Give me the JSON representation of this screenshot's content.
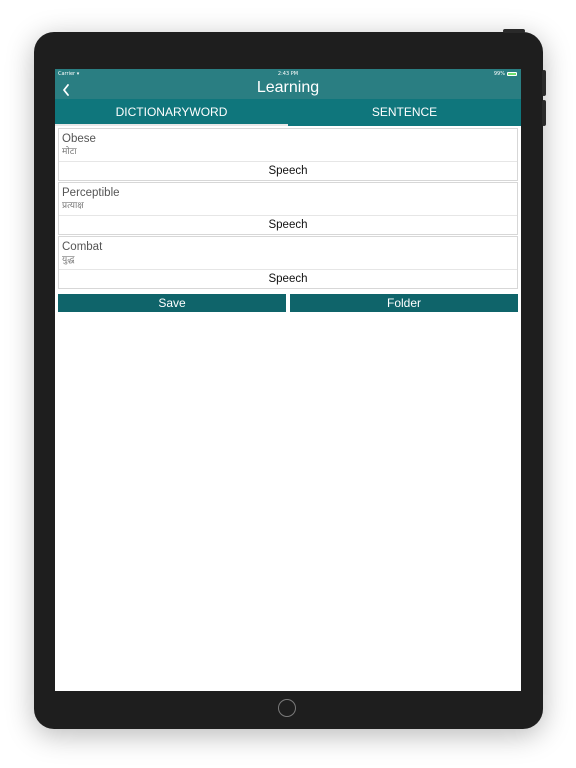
{
  "status_bar": {
    "carrier": "Carrier",
    "time": "2:43 PM",
    "battery": "99%",
    "battery_level": 0.99
  },
  "nav": {
    "title": "Learning",
    "back_icon": "chevron-left-icon"
  },
  "tabs": [
    {
      "label": "DICTIONARYWORD",
      "active": true
    },
    {
      "label": "SENTENCE",
      "active": false
    }
  ],
  "entries": [
    {
      "word": "Obese",
      "meaning": "मोटा",
      "speech_label": "Speech"
    },
    {
      "word": "Perceptible",
      "meaning": "प्रत्याक्ष",
      "speech_label": "Speech"
    },
    {
      "word": "Combat",
      "meaning": "युद्ध",
      "speech_label": "Speech"
    }
  ],
  "actions": {
    "save_label": "Save",
    "folder_label": "Folder"
  },
  "colors": {
    "navbar": "#2a7e82",
    "tabs": "#0f767c",
    "buttons": "#0f646a",
    "battery": "#6fe06f"
  }
}
